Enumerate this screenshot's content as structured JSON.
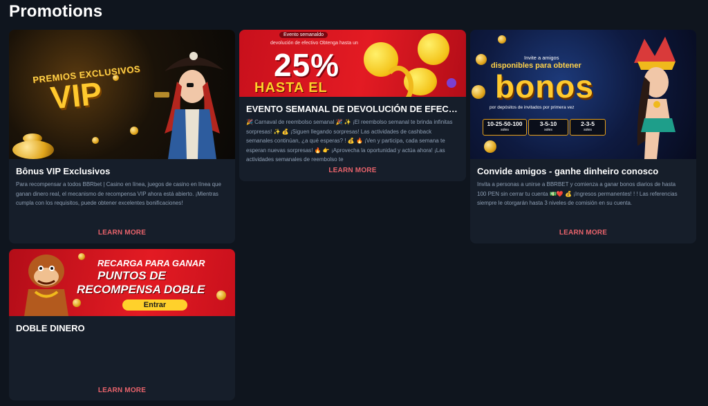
{
  "page": {
    "title": "Promotions"
  },
  "cards": [
    {
      "title": "Bônus VIP Exclusivos",
      "description": "Para recompensar a todos BBRbet | Casino en línea, juegos de casino en línea que ganan dinero real, el mecanismo de recompensa VIP ahora está abierto. ¡Mientras cumpla con los requisitos, puede obtener excelentes bonificaciones!",
      "cta": "LEARN MORE",
      "banner": {
        "line1": "PREMIOS EXCLUSIVOS",
        "line2": "VIP"
      }
    },
    {
      "title": "EVENTO SEMANAL DE DEVOLUCIÓN DE EFECTIVO",
      "description": "🎉 Carnaval de reembolso semanal 🎉 ✨ ¡El reembolso semanal te brinda infinitas sorpresas! ✨ 💰 ¡Siguen llegando sorpresas! Las actividades de cashback semanales continúan, ¿a qué esperas? ! 💰 🔥 ¡Ven y participa, cada semana te esperan nuevas sorpresas! 🔥 👉 ¡Aprovecha la oportunidad y actúa ahora! ¡Las actividades semanales de reembolso te",
      "cta": "LEARN MORE",
      "banner": {
        "tag": "Evento semanaldo",
        "sub": "devolución de efectivo Obtenga hasta un",
        "big": "25%",
        "line2": "HASTA EL"
      }
    },
    {
      "title": "Convide amigos - ganhe dinheiro conosco",
      "description": "Invita a personas a unirse a BBRBET y comienza a ganar bonos diarios de hasta 100 PEN sin cerrar tu cuenta 💵❤️ 💰 ¡Ingresos permanentes! ! ! Las referencias siempre le otorgarán hasta 3 niveles de comisión en su cuenta.",
      "cta": "LEARN MORE",
      "banner": {
        "small": "Invite a amigos",
        "yellow": "disponibles para obtener",
        "big": "bonos",
        "deposit": "por depósitos de invitados por primera vez",
        "boxes": [
          {
            "value": "10-25-50-100",
            "unit": "soles"
          },
          {
            "value": "3-5-10",
            "unit": "soles"
          },
          {
            "value": "2-3-5",
            "unit": "soles"
          }
        ]
      }
    },
    {
      "title": "DOBLE DINERO",
      "description": "",
      "cta": "LEARN MORE",
      "banner": {
        "line1": "RECARGA PARA GANAR",
        "line2": "PUNTOS DE",
        "line3": "RECOMPENSA DOBLE",
        "button": "Entrar"
      }
    }
  ],
  "icons": [
    "pirate-character",
    "dancer-character",
    "monkey-character",
    "laughing-emoji",
    "gold-coin"
  ],
  "colors": {
    "background": "#0f151e",
    "card": "#161e2a",
    "cta": "#e8636b",
    "desc": "#8fa0b5"
  }
}
